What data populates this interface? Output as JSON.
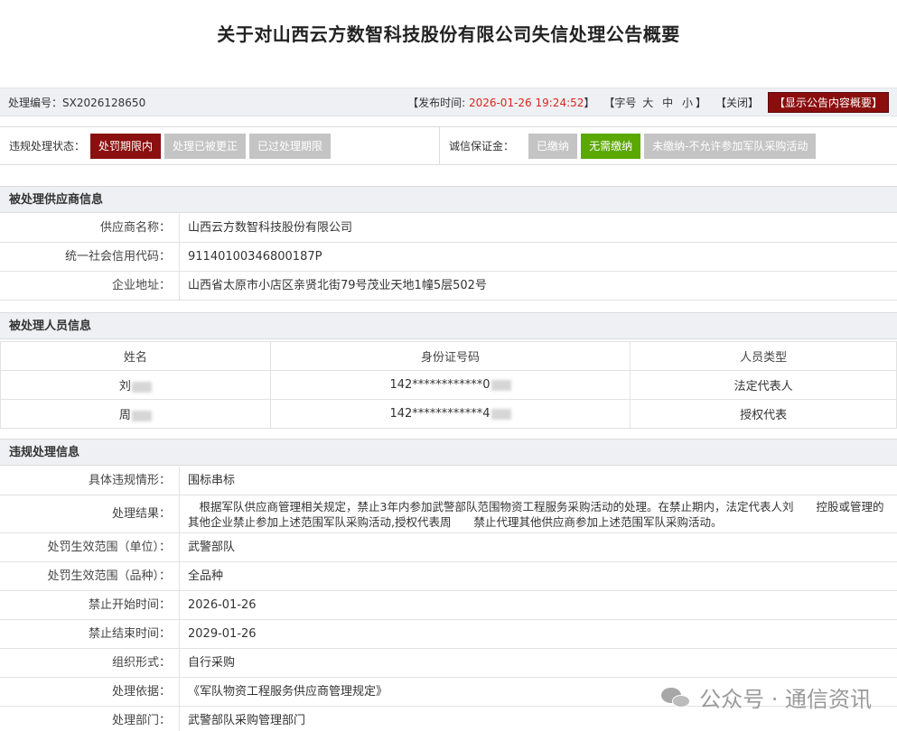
{
  "title": "关于对山西云方数智科技股份有限公司失信处理公告概要",
  "meta": {
    "process_no_label": "处理编号：",
    "process_no": "SX2026128650",
    "publish_time_label": "【发布时间:",
    "publish_time": "2026-01-26 19:24:52",
    "publish_time_close": "】",
    "font_size_label": "【字号",
    "font_large": "大",
    "font_medium": "中",
    "font_small": "小",
    "font_size_close": "】",
    "close_label": "【关闭】",
    "show_summary": "【显示公告内容概要】"
  },
  "status": {
    "violation_label": "违规处理状态：",
    "violation_options": [
      "处罚期限内",
      "处理已被更正",
      "已过处理期限"
    ],
    "deposit_label": "诚信保证金：",
    "deposit_options": [
      "已缴纳",
      "无需缴纳",
      "未缴纳-不允许参加军队采购活动"
    ]
  },
  "supplier": {
    "header": "被处理供应商信息",
    "rows": [
      {
        "k": "供应商名称：",
        "v": "山西云方数智科技股份有限公司"
      },
      {
        "k": "统一社会信用代码：",
        "v": "91140100346800187P"
      },
      {
        "k": "企业地址：",
        "v": "山西省太原市小店区亲贤北街79号茂业天地1幢5层502号"
      }
    ]
  },
  "persons": {
    "header": "被处理人员信息",
    "columns": [
      "姓名",
      "身份证号码",
      "人员类型"
    ],
    "rows": [
      {
        "name": "刘",
        "id": "142************0",
        "type": "法定代表人"
      },
      {
        "name": "周",
        "id": "142************4",
        "type": "授权代表"
      }
    ]
  },
  "violation": {
    "header": "违规处理信息",
    "rows": [
      {
        "k": "具体违规情形：",
        "v": "围标串标"
      },
      {
        "k": "处理结果：",
        "v": "　根据军队供应商管理相关规定，禁止3年内参加武警部队范围物资工程服务采购活动的处理。在禁止期内，法定代表人刘　　控股或管理的其他企业禁止参加上述范围军队采购活动,授权代表周　　禁止代理其他供应商参加上述范围军队采购活动。"
      },
      {
        "k": "处罚生效范围（单位）：",
        "v": "武警部队"
      },
      {
        "k": "处罚生效范围（品种）：",
        "v": "全品种"
      },
      {
        "k": "禁止开始时间：",
        "v": "2026-01-26"
      },
      {
        "k": "禁止结束时间：",
        "v": "2029-01-26"
      },
      {
        "k": "组织形式：",
        "v": "自行采购"
      },
      {
        "k": "处理依据：",
        "v": "《军队物资工程服务供应商管理规定》"
      },
      {
        "k": "处理部门：",
        "v": "武警部队采购管理部门"
      }
    ]
  },
  "watermark": "公众号 · 通信资讯",
  "colors": {
    "accent_red": "#8b0f0f",
    "accent_green": "#5aa800",
    "time_red": "#d9251c"
  }
}
